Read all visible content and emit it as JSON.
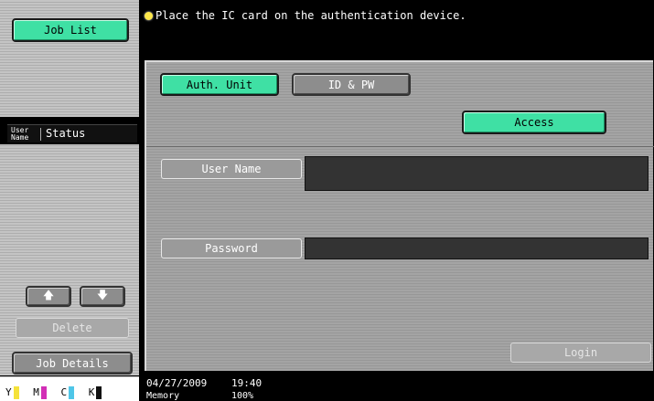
{
  "sidebar": {
    "job_list_label": "Job List",
    "col_user_name_line1": "User",
    "col_user_name_line2": "Name",
    "col_status": "Status",
    "up_arrow": "🡅",
    "down_arrow": "🡇",
    "delete_label": "Delete",
    "job_details_label": "Job Details",
    "toner": [
      {
        "letter": "Y",
        "color": "#f5e23a",
        "level": 0.7
      },
      {
        "letter": "M",
        "color": "#d22fb6",
        "level": 0.8
      },
      {
        "letter": "C",
        "color": "#4fc6e8",
        "level": 0.8
      },
      {
        "letter": "K",
        "color": "#111111",
        "level": 0.9
      }
    ]
  },
  "message": {
    "icon": "lightbulb-icon",
    "text": "Place the IC card on the authentication device."
  },
  "auth": {
    "auth_unit_label": "Auth. Unit",
    "id_pw_label": "ID & PW",
    "access_label": "Access",
    "user_name_label": "User Name",
    "user_name_value": "",
    "password_label": "Password",
    "password_value": "",
    "login_label": "Login"
  },
  "footer": {
    "date": "04/27/2009",
    "time": "19:40",
    "memory_label": "Memory",
    "memory_value": "100%"
  },
  "colors": {
    "accent_green": "#3fe0a4",
    "background": "#000000"
  }
}
